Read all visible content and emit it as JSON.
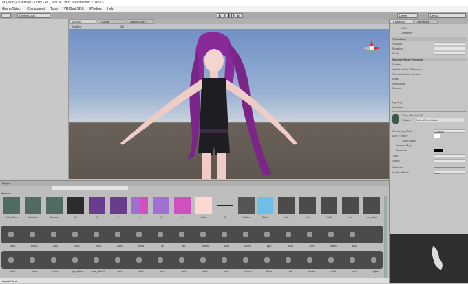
{
  "window": {
    "title": "ar (Work) - Untitled - Unity - PC, Mac & Linux Standalone* <DX11>"
  },
  "menu": [
    "GameObject",
    "Component",
    "Tools",
    "VRChat SDK",
    "Window",
    "Help"
  ],
  "toolbar": {
    "pivot": "Center  Local",
    "layers": "Layers",
    "layout": "Layout"
  },
  "tabs": [
    {
      "label": "Scene"
    },
    {
      "label": "Game"
    },
    {
      "label": "Asset Store"
    }
  ],
  "scene": {
    "shading": "Shaded",
    "mode": "2D"
  },
  "inspector": {
    "tabs": [
      "Inspector",
      "Services"
    ],
    "object_name": "Cube",
    "tag": "Untagged",
    "transform": "Transform",
    "position": "Position",
    "rotation": "Rotation",
    "scale": "Scale",
    "renderer": "Skinned Mesh Renderer",
    "rows": [
      "Quality",
      "Update When Offscreen",
      "Skinned Motion Vectors",
      "Mesh",
      "Root Bone",
      "Bounds"
    ],
    "lighting": "Lighting",
    "materials": "Materials",
    "material_name": "Tara_Miruku_UR",
    "shader_label": "Shader",
    "shader": "Cubed/Toon/Basic",
    "mat_rows": [
      "Rendering Mode",
      "Main Texture",
      "Color Mask",
      "Normal Map",
      "Emission",
      "Tiling",
      "Offset",
      "Shadow",
      "Outline Mode"
    ],
    "mat_values": [
      "Opaque",
      "None"
    ]
  },
  "project": {
    "title": "Project",
    "breadcrumb": "Assets",
    "status": "Assets/Tara",
    "row1": [
      "Cubed/Toon",
      "Materials",
      "Textures",
      "01",
      "1",
      "2",
      "3",
      "4",
      "5",
      "Body",
      "6",
      "Bodies"
    ],
    "row1b": [
      "Cube",
      "body",
      "hair",
      "hair2",
      "rod",
      "eye_offset"
    ],
    "row2": [
      "hair1",
      "Bone1",
      "hair2",
      "hair3",
      "hair4",
      "hair5",
      "Head",
      "Tail",
      "tail",
      "leaves",
      "outfit",
      "Shoes",
      "light",
      "body",
      "shirt",
      "jacket",
      "skirt"
    ],
    "row3": [
      "hair1",
      "Mesh",
      "Circle",
      "eye_offset",
      "eye_offset2",
      "hat1",
      "hat2",
      "hat3",
      "hat4",
      "hat5",
      "hat6",
      "Hood",
      "Bone",
      "tail",
      "bodies",
      "outfit",
      "wand",
      "lights"
    ]
  },
  "colors": {
    "sky": "#6d8ec4",
    "ground": "#6a6159",
    "hair": "#8a2a9a"
  }
}
